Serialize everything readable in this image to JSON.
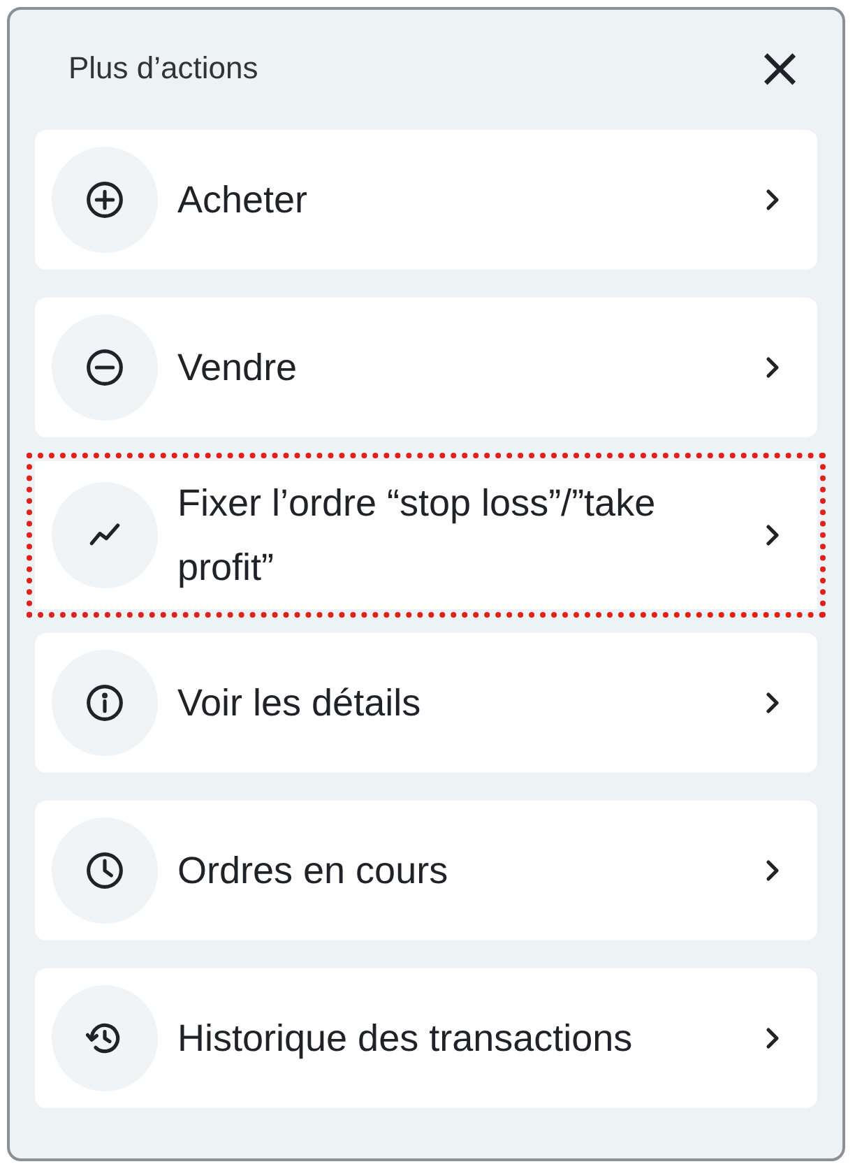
{
  "panel": {
    "title": "Plus d’actions",
    "close": "×"
  },
  "actions": [
    {
      "label": "Acheter",
      "highlighted": false
    },
    {
      "label": "Vendre",
      "highlighted": false
    },
    {
      "label": "Fixer l’ordre “stop loss”/”take profit”",
      "highlighted": true
    },
    {
      "label": "Voir les détails",
      "highlighted": false
    },
    {
      "label": "Ordres en cours",
      "highlighted": false
    },
    {
      "label": "Historique des transactions",
      "highlighted": false
    }
  ]
}
